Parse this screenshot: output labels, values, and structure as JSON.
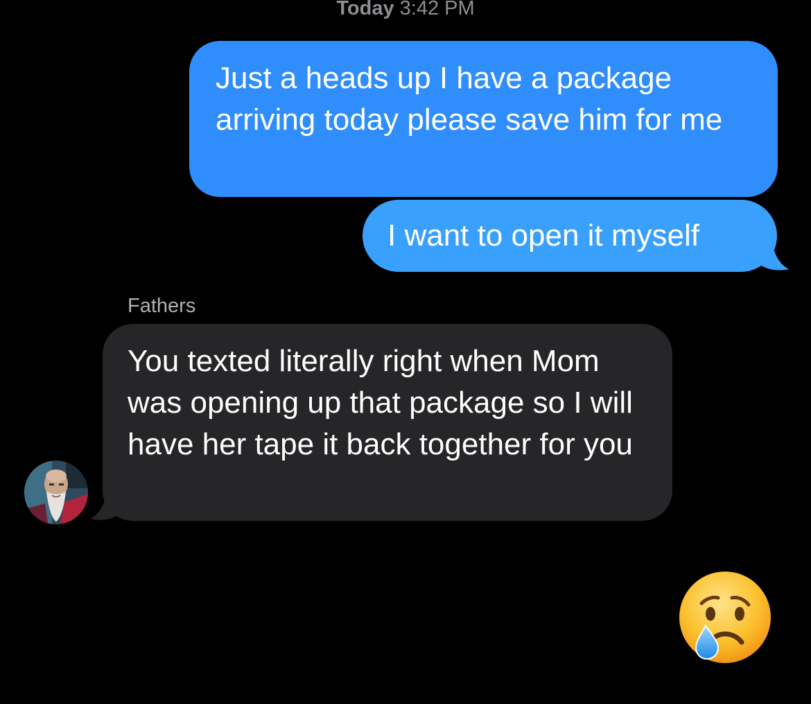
{
  "header": {
    "timestamp_day": "Today",
    "timestamp_time": "3:42 PM"
  },
  "messages": [
    {
      "direction": "sent",
      "text": "Just a heads up I have a package arriving today please save him for me",
      "color": "#2f8dfc"
    },
    {
      "direction": "sent",
      "text": "I want to open it myself",
      "color": "#3aa0fd"
    },
    {
      "direction": "received",
      "sender": "Fathers",
      "text": "You texted literally right when Mom was opening up that package so I will have her tape it back together for you",
      "color": "#262629"
    },
    {
      "direction": "sent",
      "emoji": "crying-face",
      "text": "😢"
    }
  ],
  "theme": {
    "background": "#000000",
    "meta_text": "#8e8e93"
  }
}
